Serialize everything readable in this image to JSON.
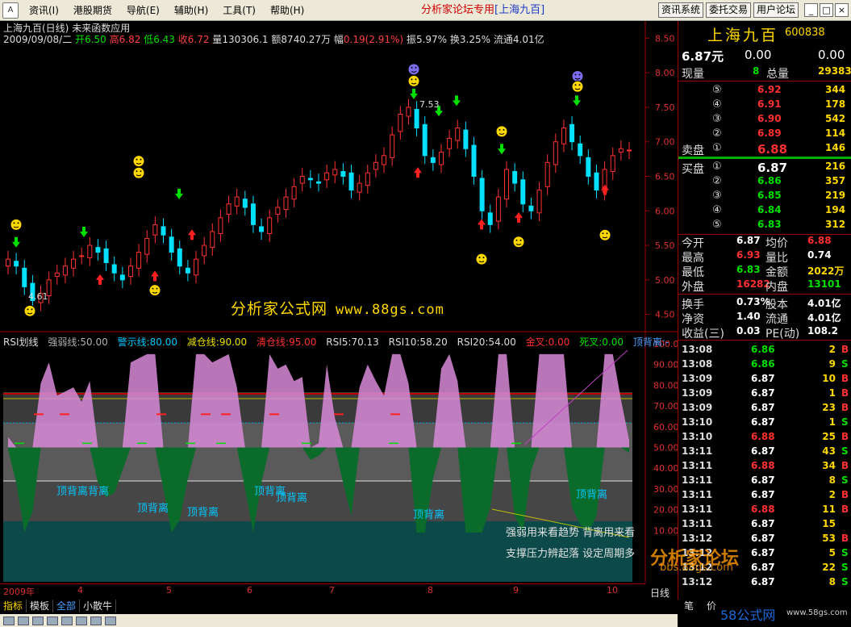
{
  "menubar": {
    "logo": "A",
    "items": [
      "资讯(I)",
      "港股期货",
      "导航(E)",
      "辅助(H)",
      "工具(T)",
      "帮助(H)"
    ],
    "title_main": "分析家论坛专用",
    "title_sub": "[上海九百]",
    "buttons": [
      "资讯系统",
      "委托交易",
      "用户论坛"
    ],
    "window_controls": [
      "_",
      "□",
      "×"
    ]
  },
  "chart": {
    "stock_label": "上海九百(日线)",
    "formula_label": "未来函数应用",
    "date": "2009/09/08/二",
    "open_label": "开",
    "open": "6.50",
    "high_label": "高",
    "high": "6.82",
    "low_label": "低",
    "low": "6.43",
    "close_label": "收",
    "close": "6.72",
    "vol_label": "量",
    "vol": "130306.1",
    "amt_label": "额",
    "amt": "8740.27万",
    "change_label": "幅",
    "change": "0.19(2.91%)",
    "amp_label": "振",
    "amp": "5.97%",
    "turn_label": "换",
    "turn": "3.25%",
    "float_label": "流通",
    "float": "4.01亿",
    "watermark_text": "分析家公式网",
    "watermark_url": "www.88gs.com",
    "rsi_line_title": "RSI划线",
    "rsi_params": [
      {
        "label": "强弱线:50.00",
        "color": "gray"
      },
      {
        "label": "警示线:80.00",
        "color": "cyan"
      },
      {
        "label": "减仓线:90.00",
        "color": "gold"
      },
      {
        "label": "清仓线:95.00",
        "color": "red"
      },
      {
        "label": "RSI5:70.13",
        "color": "white"
      },
      {
        "label": "RSI10:58.20",
        "color": "white"
      },
      {
        "label": "RSI20:54.00",
        "color": "white"
      },
      {
        "label": "金叉:0.00",
        "color": "red"
      },
      {
        "label": "死叉:0.00",
        "color": "green"
      },
      {
        "label": "顶背离:-",
        "color": "blue"
      },
      {
        "label": "J",
        "color": "red"
      }
    ],
    "divergence_label": "顶背离",
    "divergence_label_double": "顶背离背离",
    "notes": [
      "强弱用来看趋势  背离用来看",
      "支撑压力辨起落  设定周期多"
    ],
    "period": "日线",
    "date_labels": [
      "2009年",
      "4",
      "5",
      "6",
      "7",
      "8",
      "9",
      "10"
    ],
    "price_labels": [
      "8.50",
      "8.00",
      "7.50",
      "7.00",
      "6.50",
      "6.00",
      "5.50",
      "5.00",
      "4.50"
    ],
    "rsi_labels": [
      "100.00",
      "90.00",
      "80.00",
      "70.00",
      "60.00",
      "50.00",
      "40.00",
      "30.00",
      "20.00",
      "10.00"
    ],
    "high_mark": "7.53",
    "low_mark": "4.61"
  },
  "chart_data": {
    "type": "candlestick",
    "title": "上海九百(日线)",
    "ylim": [
      4.25,
      8.75
    ],
    "rsi_ylim": [
      0,
      100
    ],
    "x_months": [
      "2009年",
      "4",
      "5",
      "6",
      "7",
      "8",
      "9",
      "10"
    ],
    "series": [
      {
        "name": "强弱线",
        "values": [
          50
        ]
      },
      {
        "name": "警示线",
        "values": [
          80
        ]
      },
      {
        "name": "减仓线",
        "values": [
          90
        ]
      },
      {
        "name": "清仓线",
        "values": [
          95
        ]
      }
    ],
    "closes": [
      5.3,
      5.2,
      4.9,
      4.7,
      4.8,
      5.0,
      5.1,
      5.2,
      5.3,
      5.35,
      5.5,
      5.4,
      5.25,
      5.1,
      5.0,
      5.2,
      5.4,
      5.6,
      5.8,
      5.65,
      5.4,
      5.2,
      5.1,
      5.3,
      5.5,
      5.7,
      5.9,
      6.1,
      6.2,
      6.05,
      5.8,
      5.7,
      5.9,
      6.05,
      6.2,
      6.35,
      6.5,
      6.45,
      6.4,
      6.55,
      6.6,
      6.5,
      6.3,
      6.4,
      6.55,
      6.7,
      6.8,
      7.1,
      7.4,
      7.5,
      7.2,
      6.8,
      6.7,
      6.85,
      7.05,
      7.2,
      6.9,
      6.5,
      6.0,
      5.8,
      6.2,
      6.6,
      6.4,
      6.1,
      6.0,
      6.3,
      6.7,
      7.0,
      7.2,
      7.0,
      6.8,
      6.5,
      6.3,
      6.6,
      6.8,
      6.9,
      6.88
    ]
  },
  "quote": {
    "name": "上海九百",
    "code": "600838",
    "price": "6.87元",
    "change": "0.00",
    "change_pct": "0.00",
    "now_vol_label": "现量",
    "now_vol": "8",
    "total_vol_label": "总量",
    "total_vol": "29383",
    "sell_label": "卖盘",
    "buy_label": "买盘",
    "sells": [
      {
        "level": "⑤",
        "price": "6.92",
        "vol": "344"
      },
      {
        "level": "④",
        "price": "6.91",
        "vol": "178"
      },
      {
        "level": "③",
        "price": "6.90",
        "vol": "542"
      },
      {
        "level": "②",
        "price": "6.89",
        "vol": "114"
      },
      {
        "level": "①",
        "price": "6.88",
        "vol": "146"
      }
    ],
    "buys": [
      {
        "level": "①",
        "price": "6.87",
        "vol": "216"
      },
      {
        "level": "②",
        "price": "6.86",
        "vol": "357"
      },
      {
        "level": "③",
        "price": "6.85",
        "vol": "219"
      },
      {
        "level": "④",
        "price": "6.84",
        "vol": "194"
      },
      {
        "level": "⑤",
        "price": "6.83",
        "vol": "312"
      }
    ],
    "stats": [
      {
        "l1": "今开",
        "v1": "6.87",
        "c1": "#ffffff",
        "l2": "均价",
        "v2": "6.88",
        "c2": "#ff3030"
      },
      {
        "l1": "最高",
        "v1": "6.93",
        "c1": "#ff3030",
        "l2": "量比",
        "v2": "0.74",
        "c2": "#ffffff"
      },
      {
        "l1": "最低",
        "v1": "6.83",
        "c1": "#00e000",
        "l2": "金额",
        "v2": "2022万",
        "c2": "#ffd800"
      },
      {
        "l1": "外盘",
        "v1": "16282",
        "c1": "#ff3030",
        "l2": "内盘",
        "v2": "13101",
        "c2": "#00e000"
      },
      {
        "l1": "换手",
        "v1": "0.73%",
        "c1": "#ffffff",
        "l2": "股本",
        "v2": "4.01亿",
        "c2": "#ffffff"
      },
      {
        "l1": "净资",
        "v1": "1.40",
        "c1": "#ffffff",
        "l2": "流通",
        "v2": "4.01亿",
        "c2": "#ffffff"
      },
      {
        "l1": "收益(三)",
        "v1": "0.03",
        "c1": "#ffffff",
        "l2": "PE(动)",
        "v2": "108.2",
        "c2": "#ffffff"
      }
    ],
    "ticks": [
      {
        "time": "13:08",
        "price": "6.86",
        "vol": "2",
        "side": "B"
      },
      {
        "time": "13:08",
        "price": "6.86",
        "vol": "9",
        "side": "S"
      },
      {
        "time": "13:09",
        "price": "6.87",
        "vol": "10",
        "side": "B"
      },
      {
        "time": "13:09",
        "price": "6.87",
        "vol": "1",
        "side": "B"
      },
      {
        "time": "13:09",
        "price": "6.87",
        "vol": "23",
        "side": "B"
      },
      {
        "time": "13:10",
        "price": "6.87",
        "vol": "1",
        "side": "S"
      },
      {
        "time": "13:10",
        "price": "6.88",
        "vol": "25",
        "side": "B"
      },
      {
        "time": "13:11",
        "price": "6.87",
        "vol": "43",
        "side": "S"
      },
      {
        "time": "13:11",
        "price": "6.88",
        "vol": "34",
        "side": "B"
      },
      {
        "time": "13:11",
        "price": "6.87",
        "vol": "8",
        "side": "S"
      },
      {
        "time": "13:11",
        "price": "6.87",
        "vol": "2",
        "side": "B"
      },
      {
        "time": "13:11",
        "price": "6.88",
        "vol": "11",
        "side": "B"
      },
      {
        "time": "13:11",
        "price": "6.87",
        "vol": "15",
        "side": ""
      },
      {
        "time": "13:12",
        "price": "6.87",
        "vol": "53",
        "side": "B"
      },
      {
        "time": "13:12",
        "price": "6.87",
        "vol": "5",
        "side": "S"
      },
      {
        "time": "13:12",
        "price": "6.87",
        "vol": "22",
        "side": "S"
      },
      {
        "time": "13:12",
        "price": "6.87",
        "vol": "8",
        "side": "S"
      }
    ]
  },
  "bottom": {
    "tabs": [
      "指标",
      "模板",
      "全部",
      "小散牛"
    ],
    "quote_tabs": [
      "笔",
      "价"
    ],
    "site_logo": "58公式网",
    "site_url": "www.58gs.com",
    "forum_logo": "分析家论坛",
    "forum_url": "bbs.88gs.com"
  },
  "colors": {
    "up": "#ff3030",
    "down": "#00e0ff",
    "rsi_fill_pink": "#d889d8",
    "rsi_fill_green": "#0a6b2a",
    "background": "#000000",
    "panel_border": "#a00000"
  }
}
